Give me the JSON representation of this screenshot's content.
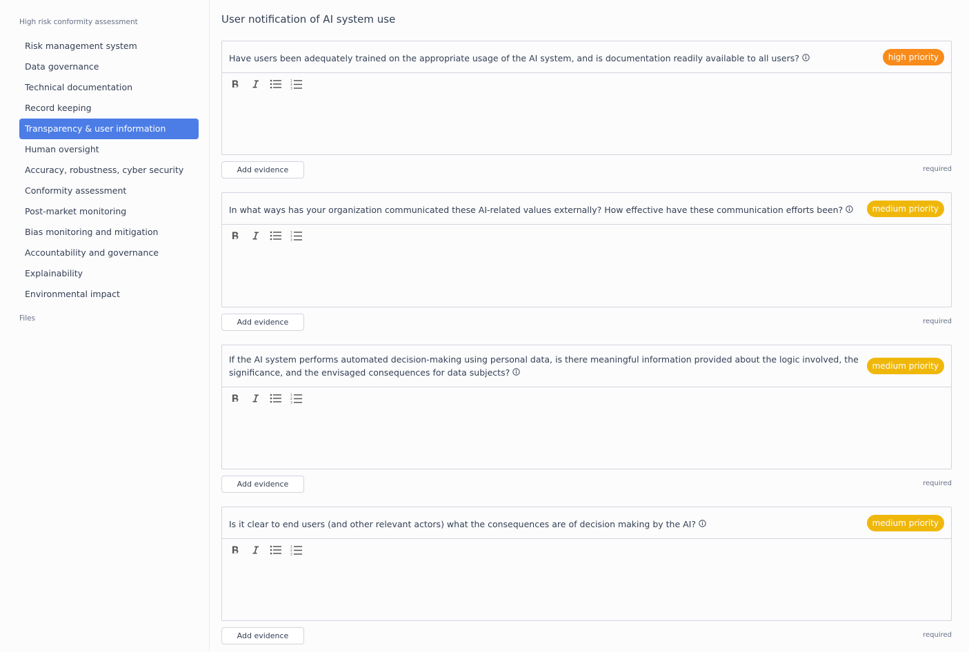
{
  "sidebar": {
    "heading": "High risk conformity assessment",
    "items": [
      {
        "label": "Risk management system"
      },
      {
        "label": "Data governance"
      },
      {
        "label": "Technical documentation"
      },
      {
        "label": "Record keeping"
      },
      {
        "label": "Transparency & user information",
        "active": true
      },
      {
        "label": "Human oversight"
      },
      {
        "label": "Accuracy, robustness, cyber security"
      },
      {
        "label": "Conformity assessment"
      },
      {
        "label": "Post-market monitoring"
      },
      {
        "label": "Bias monitoring and mitigation"
      },
      {
        "label": "Accountability and governance"
      },
      {
        "label": "Explainability"
      },
      {
        "label": "Environmental impact"
      }
    ],
    "files_label": "Files"
  },
  "main": {
    "title": "User notification of AI system use",
    "questions": [
      {
        "text": "Have users been adequately trained on the appropriate usage of the AI system, and is documentation readily available to all users?",
        "priority": "high priority",
        "add_evidence": "Add evidence",
        "required": "required"
      },
      {
        "text": "In what ways has your organization communicated these AI-related values externally? How effective have these communication efforts been?",
        "priority": "medium priority",
        "add_evidence": "Add evidence",
        "required": "required"
      },
      {
        "text": "If the AI system performs automated decision-making using personal data, is there meaningful information provided about the logic involved, the significance, and the envisaged consequences for data subjects?",
        "priority": "medium priority",
        "add_evidence": "Add evidence",
        "required": "required"
      },
      {
        "text": "Is it clear to end users (and other relevant actors) what the consequences are of decision making by the AI?",
        "priority": "medium priority",
        "add_evidence": "Add evidence",
        "required": "required"
      }
    ]
  },
  "colors": {
    "accent": "#4c7de7",
    "high_priority": "#f88b1a",
    "medium_priority": "#f0b70b",
    "border": "#d0d5dd"
  },
  "icons": [
    "bold-icon",
    "italic-icon",
    "bullet-list-icon",
    "numbered-list-icon",
    "info-icon"
  ]
}
